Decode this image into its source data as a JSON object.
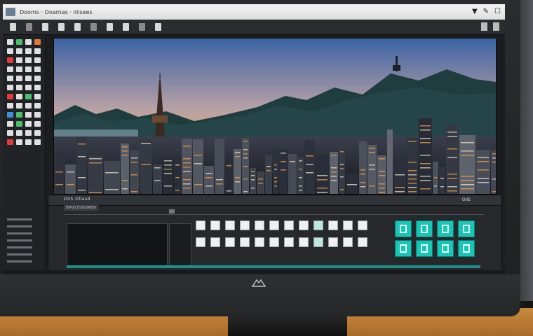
{
  "window": {
    "title": "Dooms · Ooarnas · iiiisees",
    "right_icons": [
      "pin-icon",
      "pen-icon",
      "close-icon"
    ]
  },
  "toolbar": {
    "tools": [
      "tool-1",
      "tool-2",
      "tool-3",
      "tool-4",
      "tool-5",
      "tool-6",
      "tool-7",
      "tool-8",
      "tool-9",
      "tool-10"
    ],
    "end_tools": [
      "panel-toggle-icon",
      "close-panel-icon"
    ]
  },
  "palette": {
    "swatches": [
      "#e0e0e0",
      "#4bbf6b",
      "#e0e0e0",
      "#e07a3a",
      "#e0e0e0",
      "#e0e0e0",
      "#e0e0e0",
      "#e0e0e0",
      "#e33b3b",
      "#e0e0e0",
      "#e0e0e0",
      "#e0e0e0",
      "#e0e0e0",
      "#e0e0e0",
      "#e0e0e0",
      "#e0e0e0",
      "#e0e0e0",
      "#e0e0e0",
      "#e0e0e0",
      "#e0e0e0",
      "#e0e0e0",
      "#e0e0e0",
      "#e0e0e0",
      "#e0e0e0",
      "#e33b3b",
      "#e0e0e0",
      "#4bbf6b",
      "#e0e0e0",
      "#e0e0e0",
      "#e0e0e0",
      "#e0e0e0",
      "#e0e0e0",
      "#3a8fe0",
      "#4bbf6b",
      "#e0e0e0",
      "#e0e0e0",
      "#e0e0e0",
      "#4bbf6b",
      "#e0e0e0",
      "#e0e0e0",
      "#e0e0e0",
      "#e0e0e0",
      "#e0e0e0",
      "#e0e0e0",
      "#e33b3b",
      "#e0e0e0",
      "#e0e0e0",
      "#e0e0e0"
    ]
  },
  "viewport": {
    "image": "city skyline at dusk with mountains and tower",
    "colors": {
      "sky_top": "#3f6aa8",
      "sky_mid": "#e8a868",
      "sky_horizon": "#f3c27a",
      "mountain": "#1d3a3a",
      "city": "#2a2d36",
      "lights": "#f0a04a"
    }
  },
  "panel": {
    "title": "DSS Ohasd",
    "subtitle": "BMVS EVDOMIER",
    "right_label": "OIIS",
    "pads_rows": 2,
    "pads_cols": 12,
    "highlight_pad": 8,
    "big_pads": 8,
    "accent": "#18c6b6"
  },
  "monitor": {
    "brand": "brand-logo"
  }
}
